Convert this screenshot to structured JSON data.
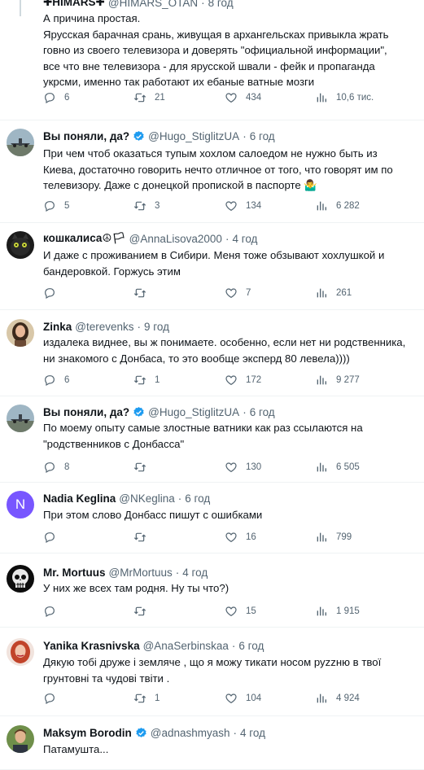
{
  "colors": {
    "text": "#0f1419",
    "secondary": "#536471",
    "verified": "#1d9bf0",
    "divider": "#eff3f4"
  },
  "icons": {
    "reply": "speech-bubble-icon",
    "retweet": "retweet-arrows-icon",
    "like": "heart-icon",
    "views": "bar-chart-icon",
    "verified": "verified-badge-icon"
  },
  "tweets": [
    {
      "name": "✚HIMARS✚",
      "handle": "@HIMARS_OTAN",
      "time": "8 год",
      "text": "А причина простая.\nЯрусская барачная срань, живущая в архангельсках привыкла жрать\nговно из своего телевизора и доверять \"официальной информации\",\nвсе что вне телевизора - для ярусской швали - фейк и пропаганда\nукрсми, именно так работают их ебаные ватные мозги",
      "replies": "6",
      "retweets": "21",
      "likes": "434",
      "views": "10,6 тис."
    },
    {
      "name": "Вы поняли, да?",
      "handle": "@Hugo_StiglitzUA",
      "time": "6 год",
      "text": "При чем чтоб оказаться тупым хохлом салоедом не нужно быть из\nКиева, достаточно говорить нечто отличное от того, что говорят им по\nтелевизору. Даже с донецкой пропиской в паспорте 🤷‍♂️",
      "replies": "5",
      "retweets": "3",
      "likes": "134",
      "views": "6 282"
    },
    {
      "name": "кошкалиса☮🏳",
      "handle": "@AnnaLisova2000",
      "time": "4 год",
      "text": "И даже с проживанием в Сибири. Меня тоже обзывают хохлушкой и\nбандеровкой. Горжусь этим",
      "replies": "",
      "retweets": "",
      "likes": "7",
      "views": "261"
    },
    {
      "name": "Zinka",
      "handle": "@terevenks",
      "time": "9 год",
      "text": "издалека виднее, вы ж понимаете. особенно, если нет ни родственника,\nни знакомого с Донбаса, то это вообще эксперд 80 левела))))",
      "replies": "6",
      "retweets": "1",
      "likes": "172",
      "views": "9 277"
    },
    {
      "name": "Вы поняли, да?",
      "handle": "@Hugo_StiglitzUA",
      "time": "6 год",
      "text": "По моему опыту самые злостные ватники как раз ссылаются на\n\"родственников с Донбасса\"",
      "replies": "8",
      "retweets": "",
      "likes": "130",
      "views": "6 505"
    },
    {
      "name": "Nadia Keglina",
      "handle": "@NKeglina",
      "time": "6 год",
      "text": "При этом слово Донбасс пишут с ошибками",
      "replies": "",
      "retweets": "",
      "likes": "16",
      "views": "799",
      "avatar_letter": "N"
    },
    {
      "name": "Mr. Mortuus",
      "handle": "@MrMortuus",
      "time": "4 год",
      "text": "У них же всех там родня. Ну ты что?)",
      "replies": "",
      "retweets": "",
      "likes": "15",
      "views": "1 915"
    },
    {
      "name": "Yanika Krasnivska",
      "handle": "@AnaSerbinskaa",
      "time": "6 год",
      "text": "Дякую тобі друже і земляче , що я можу тикати носом руzzню в твої\nгрунтовні та чудові твіти .",
      "replies": "",
      "retweets": "1",
      "likes": "104",
      "views": "4 924"
    },
    {
      "name": "Maksym Borodin",
      "handle": "@adnashmyash",
      "time": "4 год",
      "text": "Патамушта...",
      "replies": "",
      "retweets": "",
      "likes": "",
      "views": ""
    }
  ]
}
